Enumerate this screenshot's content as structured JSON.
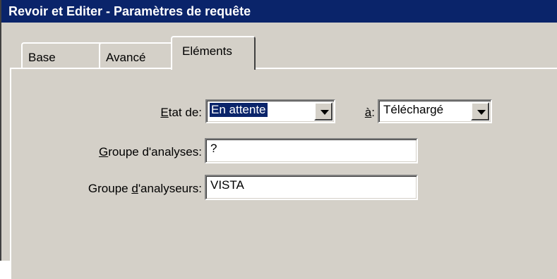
{
  "window": {
    "title": "Revoir et Editer - Paramètres de requête"
  },
  "tabs": [
    {
      "label": "Base",
      "active": false
    },
    {
      "label": "Avancé",
      "active": false
    },
    {
      "label": "Eléments",
      "active": true
    }
  ],
  "form": {
    "etat_de": {
      "label_u": "E",
      "label_rest": "tat de:",
      "value": "En attente"
    },
    "a": {
      "label_u": "à",
      "label_rest": ":",
      "value": "Téléchargé"
    },
    "groupe_analyses": {
      "label_u": "G",
      "label_rest": "roupe d'analyses:",
      "value": "?"
    },
    "groupe_analyseurs": {
      "label_pre": "Groupe ",
      "label_u": "d",
      "label_rest": "'analyseurs:",
      "value": "VISTA"
    }
  },
  "colors": {
    "titlebar": "#0a246a",
    "face": "#d4d0c8",
    "selection": "#0a246a"
  },
  "icons": {
    "dropdown": "chevron-down-icon"
  }
}
